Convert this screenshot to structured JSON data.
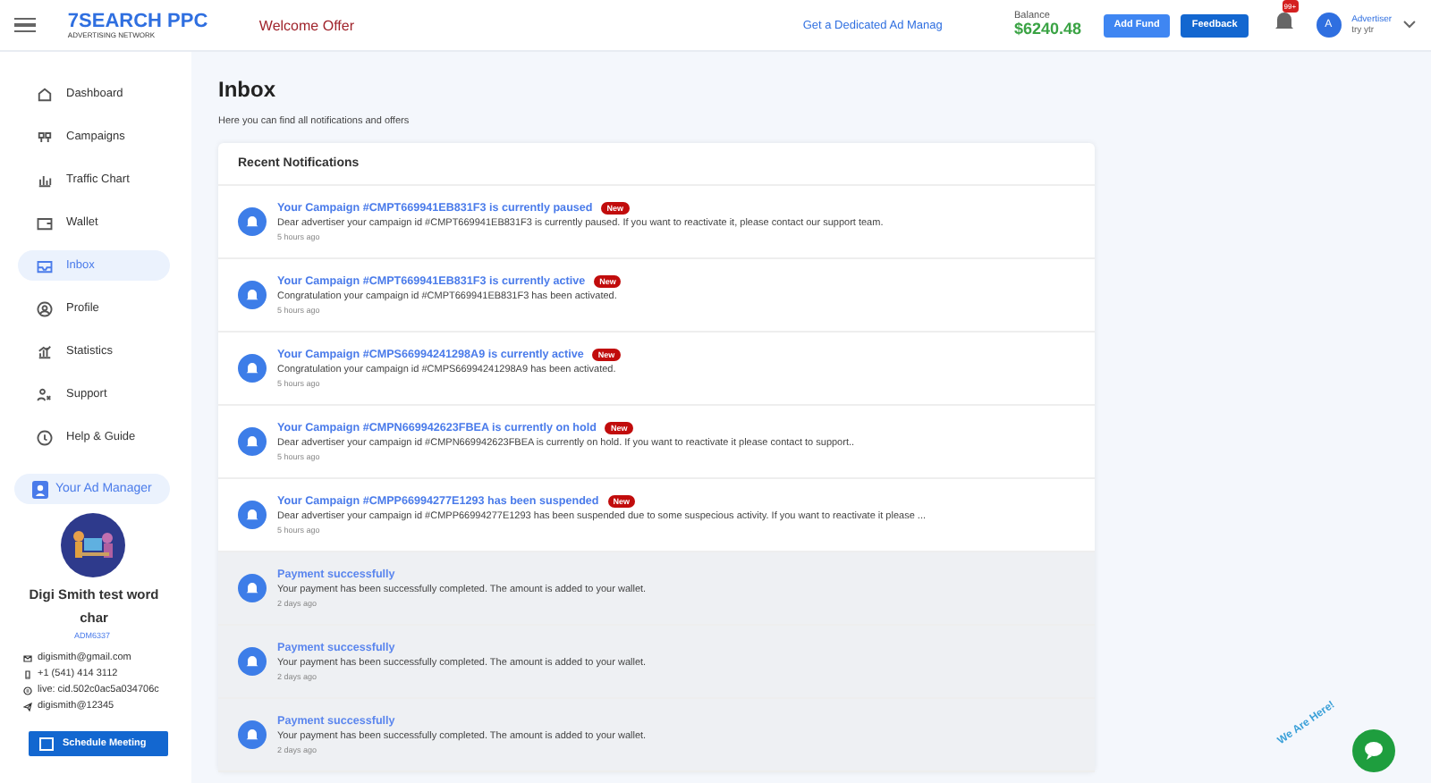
{
  "header": {
    "logo_title": "7SEARCH PPC",
    "logo_subtitle": "ADVERTISING NETWORK",
    "welcome": "Welcome Offer",
    "promo": "Get a Dedicated Ad Manag",
    "balance_label": "Balance",
    "balance": "$6240.48",
    "buttons": [
      "Add Fund",
      "Feedback"
    ],
    "notification_count": "99+",
    "avatar_letter": "A",
    "user_role": "Advertiser",
    "user_name": "try ytr"
  },
  "sidebar": {
    "items": [
      {
        "label": "Dashboard",
        "selected": false
      },
      {
        "label": "Campaigns",
        "selected": false
      },
      {
        "label": "Traffic Chart",
        "selected": false
      },
      {
        "label": "Wallet",
        "selected": false
      },
      {
        "label": "Inbox",
        "selected": true
      },
      {
        "label": "Profile",
        "selected": false
      },
      {
        "label": "Statistics",
        "selected": false
      },
      {
        "label": "Support",
        "selected": false
      },
      {
        "label": "Help & Guide",
        "selected": false
      }
    ],
    "manager": {
      "title": "Your Ad Manager",
      "name": "Digi Smith test word char",
      "id": "ADM6337",
      "contacts": [
        {
          "kind": "email",
          "text": "digismith@gmail.com"
        },
        {
          "kind": "phone",
          "text": "+1 (541) 414 3112"
        },
        {
          "kind": "skype",
          "text": "live: cid.502c0ac5a034706c"
        },
        {
          "kind": "telegram",
          "text": "digismith@12345"
        }
      ],
      "button": "Schedule Meeting"
    }
  },
  "page": {
    "title": "Inbox",
    "subtitle": "Here you can find all notifications and offers"
  },
  "notifications": {
    "title": "Recent Notifications",
    "items": [
      {
        "title": "Your Campaign #CMPT669941EB831F3 is currently paused",
        "badge": "New",
        "read": false,
        "message": "Dear advertiser your campaign id #CMPT669941EB831F3 is currently paused. If you want to reactivate it, please contact our support team.",
        "time": "5 hours ago"
      },
      {
        "title": "Your Campaign #CMPT669941EB831F3 is currently active",
        "badge": "New",
        "read": false,
        "message": "Congratulation your campaign id #CMPT669941EB831F3 has been activated.",
        "time": "5 hours ago"
      },
      {
        "title": "Your Campaign #CMPS66994241298A9 is currently active",
        "badge": "New",
        "read": false,
        "message": "Congratulation your campaign id #CMPS66994241298A9 has been activated.",
        "time": "5 hours ago"
      },
      {
        "title": "Your Campaign #CMPN669942623FBEA is currently on hold",
        "badge": "New",
        "read": false,
        "message": "Dear advertiser your campaign id #CMPN669942623FBEA is currently on hold. If you want to reactivate it please contact to support..",
        "time": "5 hours ago"
      },
      {
        "title": "Your Campaign #CMPP66994277E1293 has been suspended",
        "badge": "New",
        "read": false,
        "message": "Dear advertiser your campaign id #CMPP66994277E1293 has been suspended due to some suspecious activity. If you want to reactivate it please ...",
        "time": "5 hours ago"
      },
      {
        "title": "Payment successfully",
        "read": true,
        "message": "Your payment has been successfully completed. The amount is added to your wallet.",
        "time": "2 days ago"
      },
      {
        "title": "Payment successfully",
        "read": true,
        "message": "Your payment has been successfully completed. The amount is added to your wallet.",
        "time": "2 days ago"
      },
      {
        "title": "Payment successfully",
        "read": true,
        "message": "Your payment has been successfully completed. The amount is added to your wallet.",
        "time": "2 days ago"
      }
    ]
  },
  "chat": {
    "label": "We Are Here!"
  }
}
